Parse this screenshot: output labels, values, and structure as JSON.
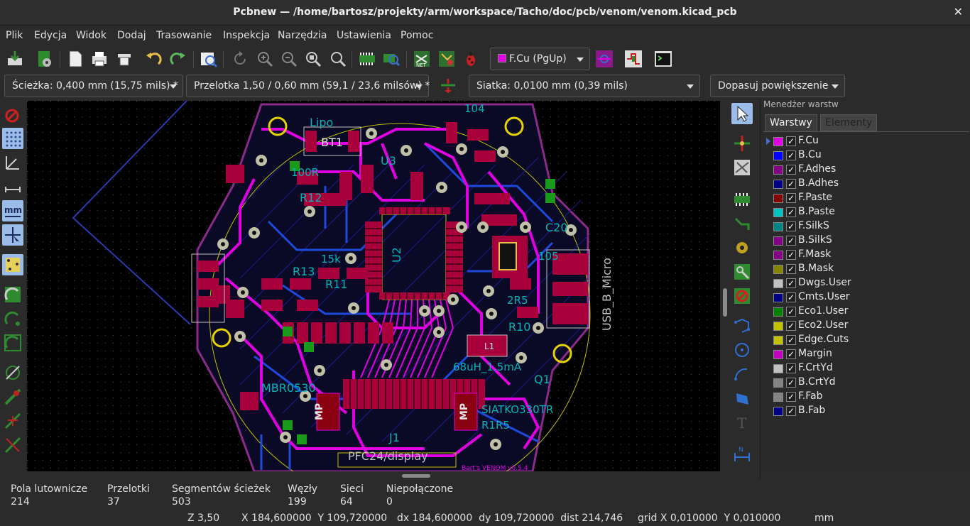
{
  "window": {
    "title": "Pcbnew — /home/bartosz/projekty/arm/workspace/Tacho/doc/pcb/venom/venom.kicad_pcb",
    "close_glyph": "✕"
  },
  "menu": [
    "Plik",
    "Edycja",
    "Widok",
    "Dodaj",
    "Trasowanie",
    "Inspekcja",
    "Narzędzia",
    "Ustawienia",
    "Pomoc"
  ],
  "toolbar": {
    "layer_selector": "F.Cu (PgUp)",
    "layer_color": "#e100e1",
    "icons": [
      "save-board-icon",
      "page-settings-icon",
      "plot-icon",
      "print-icon",
      "copy-clipboard-icon",
      "undo-icon",
      "redo-icon",
      "find-icon",
      "redraw-icon",
      "zoom-in-icon",
      "zoom-out-icon",
      "zoom-fit-icon",
      "zoom-area-icon",
      "footprint-editor-icon",
      "footprint-viewer-icon",
      "netlist-icon",
      "update-pcb-icon",
      "drc-bug-icon",
      "autoroute-icon",
      "microwave-icon",
      "scripting-console-icon"
    ]
  },
  "toolbar2": {
    "track": "Ścieżka: 0,400 mm (15,75 mils) *",
    "via": "Przelotka 1,50 / 0,60 mm (59,1 / 23,6 milsów) *",
    "grid": "Siatka: 0,0100 mm (0,39 mils)",
    "zoom": "Dopasuj powiększenie"
  },
  "left_tools": [
    "drc-off-icon",
    "grid-toggle-icon",
    "polar-coords-icon",
    "inch-units-icon",
    "mm-units-icon",
    "cursor-shape-icon",
    "ratsnest-icon",
    "zone-fill-icon",
    "zone-outline-icon",
    "zone-sketch-icon",
    "track-sketch-icon",
    "high-contrast-icon",
    "via-sketch-icon",
    "layers-manager-icon"
  ],
  "right_tools": [
    "select-arrow-icon",
    "highlight-net-icon",
    "local-ratsnest-icon",
    "add-footprint-icon",
    "route-track-icon",
    "add-via-icon",
    "add-zone-icon",
    "add-keepout-icon",
    "add-line-icon",
    "add-circle-icon",
    "add-arc-icon",
    "add-polygon-icon",
    "add-text-icon",
    "add-dimension-icon"
  ],
  "layers_panel": {
    "header": "Menedżer warstw",
    "tabs": [
      "Warstwy",
      "Elementy"
    ],
    "layers": [
      {
        "name": "F.Cu",
        "color": "#e100e1",
        "checked": true,
        "active": true
      },
      {
        "name": "B.Cu",
        "color": "#0000ff",
        "checked": true
      },
      {
        "name": "F.Adhes",
        "color": "#840084",
        "checked": true
      },
      {
        "name": "B.Adhes",
        "color": "#000084",
        "checked": true
      },
      {
        "name": "F.Paste",
        "color": "#840000",
        "checked": true
      },
      {
        "name": "B.Paste",
        "color": "#00c2c2",
        "checked": true
      },
      {
        "name": "F.SilkS",
        "color": "#008484",
        "checked": true
      },
      {
        "name": "B.SilkS",
        "color": "#840084",
        "checked": true
      },
      {
        "name": "F.Mask",
        "color": "#840084",
        "checked": true
      },
      {
        "name": "B.Mask",
        "color": "#848400",
        "checked": true
      },
      {
        "name": "Dwgs.User",
        "color": "#c2c2c2",
        "checked": true
      },
      {
        "name": "Cmts.User",
        "color": "#000084",
        "checked": true
      },
      {
        "name": "Eco1.User",
        "color": "#008400",
        "checked": true
      },
      {
        "name": "Eco2.User",
        "color": "#c2c200",
        "checked": true
      },
      {
        "name": "Edge.Cuts",
        "color": "#c2c200",
        "checked": true
      },
      {
        "name": "Margin",
        "color": "#c200c2",
        "checked": true
      },
      {
        "name": "F.CrtYd",
        "color": "#c2c2c2",
        "checked": true
      },
      {
        "name": "B.CrtYd",
        "color": "#848484",
        "checked": true
      },
      {
        "name": "F.Fab",
        "color": "#848484",
        "checked": true
      },
      {
        "name": "B.Fab",
        "color": "#000084",
        "checked": true
      }
    ]
  },
  "board_labels": {
    "u2": "U2",
    "u3": "U3",
    "j1": "J1",
    "bt1": "BT1",
    "lipo": "Lipo",
    "usb": "USB_B_Micro",
    "display": "PFC24/display",
    "r10": "R10",
    "r11": "R11",
    "r12": "R12",
    "r13": "R13",
    "q1": "Q1",
    "l1": "L1",
    "l1_val": "68uH_1.5mA",
    "mbr": "MBR0530",
    "mp": "MP",
    "c20": "C20",
    "n104": "104",
    "n105": "105",
    "n15k": "15k",
    "n100r": "100R",
    "n2r5": "2R5",
    "sila": "SIATKO330TR",
    "r1r5": "R1R5",
    "venom": "Bart's VENOM v0.5.4"
  },
  "status": {
    "pads_label": "Pola lutownicze",
    "pads_value": "214",
    "vias_label": "Przelotki",
    "vias_value": "37",
    "segs_label": "Segmentów ścieżek",
    "segs_value": "503",
    "nodes_label": "Węzły",
    "nodes_value": "199",
    "nets_label": "Sieci",
    "nets_value": "64",
    "unconn_label": "Niepołączone",
    "unconn_value": "0",
    "zoom": "Z 3,50",
    "xy": "X 184,600000  Y 109,720000",
    "dxy": "dx 184,600000  dy 109,720000  dist 214,746",
    "grid": "grid X 0,010000  Y 0,010000",
    "units": "mm"
  }
}
